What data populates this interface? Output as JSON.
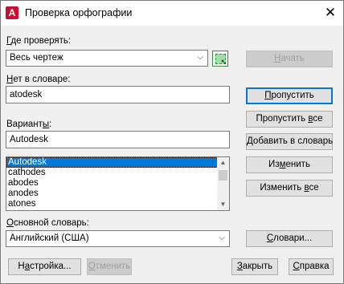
{
  "dialog": {
    "title": "Проверка орфографии",
    "app_icon_letter": "A",
    "close_glyph": "✕"
  },
  "where_to_check": {
    "label_u": "Г",
    "label_rest": "де проверять:",
    "value": "Весь чертеж",
    "start_button": {
      "label_u": "Н",
      "label_rest": "ачать"
    }
  },
  "not_in_dictionary": {
    "label_u": "Н",
    "label_rest": "ет в словаре:",
    "value": "atodesk"
  },
  "suggestions": {
    "label_pre": "Вариант",
    "label_u": "ы",
    "label_post": ":",
    "value": "Autodesk",
    "items": [
      "Autodesk",
      "cathodes",
      "abodes",
      "anodes",
      "atones"
    ],
    "selected_index": 0
  },
  "buttons": {
    "ignore": {
      "label_u": "П",
      "label_rest": "ропустить"
    },
    "ignore_all": {
      "label_pre": "Пропустить ",
      "label_u": "в",
      "label_post": "се"
    },
    "add": {
      "label_pre": "",
      "label_u": "Д",
      "label_post": "обавить в словарь"
    },
    "change": {
      "label_pre": "Из",
      "label_u": "м",
      "label_post": "енить"
    },
    "change_all": {
      "label_pre": "Изменить ",
      "label_u": "в",
      "label_post": "се"
    },
    "dictionaries": {
      "label_pre": "",
      "label_u": "С",
      "label_post": "ловари..."
    },
    "settings": {
      "label_pre": "Н",
      "label_u": "а",
      "label_post": "стройка..."
    },
    "undo": {
      "label_pre": "",
      "label_u": "О",
      "label_post": "тменить"
    },
    "close": {
      "label_pre": "",
      "label_u": "З",
      "label_post": "акрыть"
    },
    "help": {
      "label_pre": "",
      "label_u": "С",
      "label_post": "правка"
    }
  },
  "main_dictionary": {
    "label_u": "О",
    "label_rest": "сновной словарь:",
    "value": "Английский (США)"
  }
}
